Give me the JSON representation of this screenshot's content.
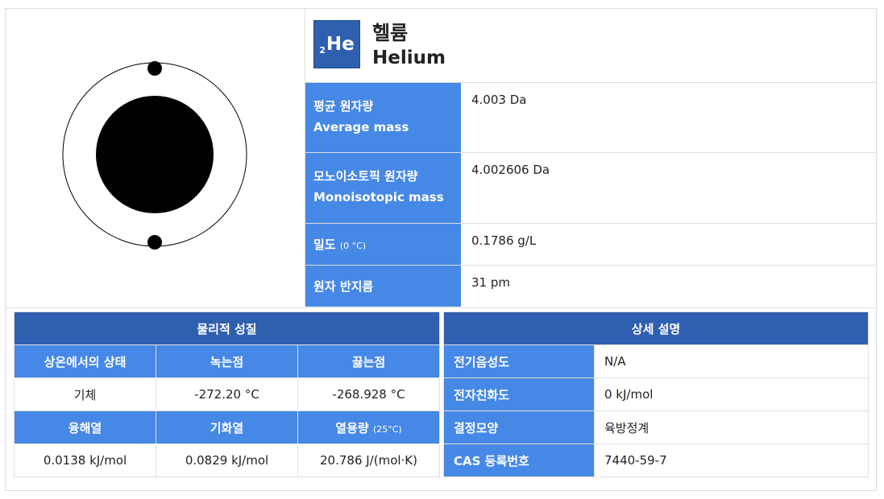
{
  "element": {
    "number": "2",
    "symbol": "He",
    "name_ko": "헬륨",
    "name_en": "Helium"
  },
  "properties": [
    {
      "label_ko": "평균 원자량",
      "label_en": "Average mass",
      "value": "4.003 Da"
    },
    {
      "label_ko": "모노이소토픽 원자량",
      "label_en": "Monoisotopic mass",
      "value": "4.002606 Da"
    },
    {
      "label_ko": "밀도",
      "label_sub": "(0 °C)",
      "value": "0.1786 g/L"
    },
    {
      "label_ko": "원자 반지름",
      "value": "31 pm"
    }
  ],
  "physical": {
    "title": "물리적 성질",
    "headers_row1": [
      "상온에서의 상태",
      "녹는점",
      "끓는점"
    ],
    "values_row1": [
      "기체",
      "-272.20 °C",
      "-268.928 °C"
    ],
    "headers_row2": [
      "융해열",
      "기화열",
      "열용량"
    ],
    "headers_row2_sub": "(25°C)",
    "values_row2": [
      "0.0138 kJ/mol",
      "0.0829 kJ/mol",
      "20.786 J/(mol·K)"
    ]
  },
  "details": {
    "title": "상세 설명",
    "rows": [
      {
        "label": "전기음성도",
        "value": "N/A"
      },
      {
        "label": "전자친화도",
        "value": "0 kJ/mol"
      },
      {
        "label": "결정모양",
        "value": "육방정계"
      },
      {
        "label": "CAS 등록번호",
        "value": "7440-59-7"
      }
    ]
  },
  "colors": {
    "header_dark": "#2f5faf",
    "label_blue": "#4688e6",
    "nucleus": "#000000"
  }
}
